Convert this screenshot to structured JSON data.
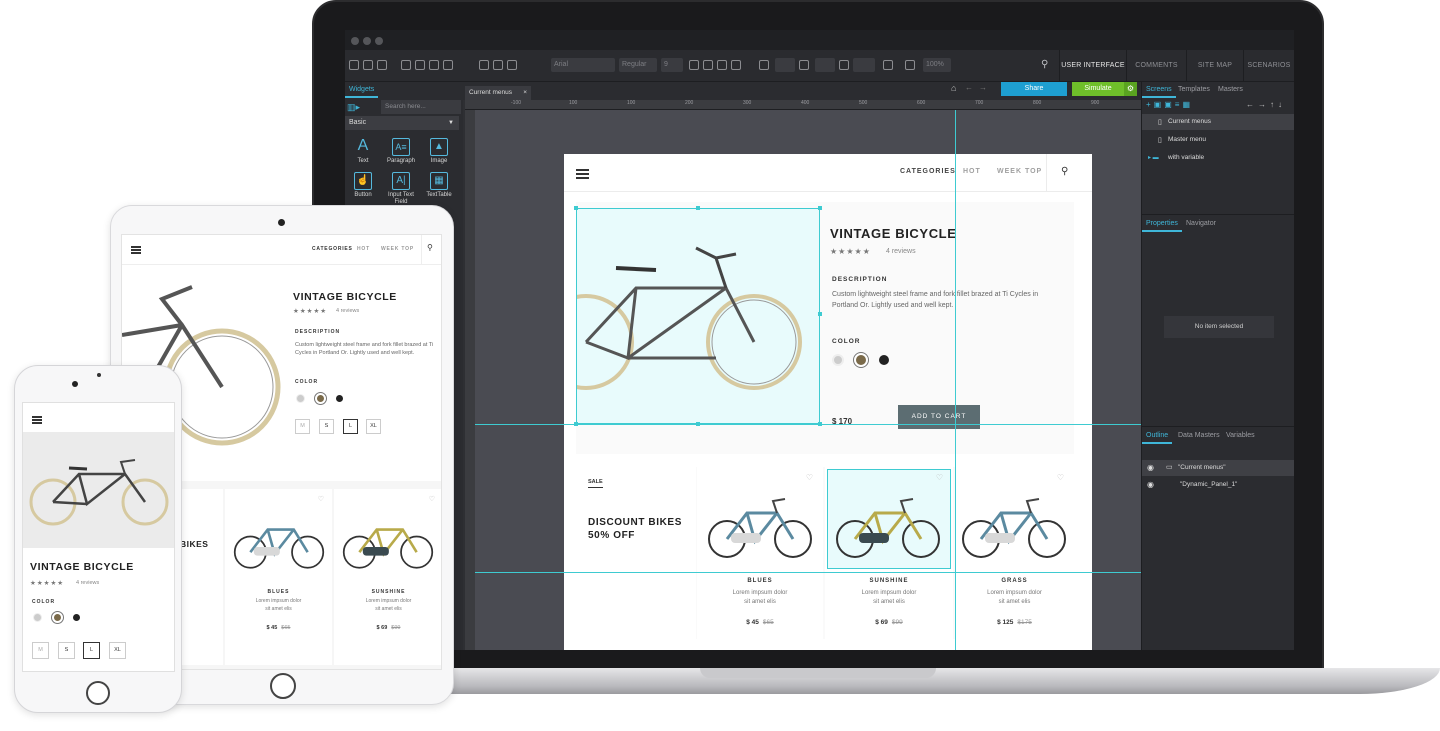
{
  "editor": {
    "zoom": "100%",
    "font_field": "Arial",
    "style_field": "Regular",
    "size_field": "9",
    "top_tabs": [
      "USER INTERFACE",
      "COMMENTS",
      "SITE MAP",
      "SCENARIOS"
    ],
    "left_tab": "Widgets",
    "search_placeholder": "Search here...",
    "library": "Basic",
    "widgets": [
      "Text",
      "Paragraph",
      "Image",
      "Button",
      "Input Text Field",
      "TextTable"
    ],
    "doc_tab": "Current menus",
    "share_label": "Share",
    "simulate_label": "Simulate",
    "ruler_marks": [
      "-100",
      "100",
      "100",
      "200",
      "300",
      "400",
      "500",
      "600",
      "700",
      "800",
      "900",
      "1000",
      "1100"
    ],
    "right_tabs": [
      "Screens",
      "Templates",
      "Masters"
    ],
    "screens": [
      "Current menus",
      "Master menu",
      "with variable"
    ],
    "prop_tabs": [
      "Properties",
      "Navigator"
    ],
    "no_item": "No item selected",
    "outline_tabs": [
      "Outline",
      "Data Masters",
      "Variables"
    ],
    "outline_items": [
      "\"Current menus\"",
      "\"Dynamic_Panel_1\""
    ],
    "accent": "#3fb6d8",
    "share_color": "#1e9fd1",
    "simulate_color": "#6fbf2a"
  },
  "design": {
    "nav": [
      "CATEGORIES",
      "HOT",
      "WEEK TOP"
    ],
    "product": {
      "title": "VINTAGE BICYCLE",
      "stars": "★★★★★",
      "reviews": "4 reviews",
      "description_label": "DESCRIPTION",
      "description": "Custom lightweight steel frame and fork fillet brazed at Ti Cycles in Portland Or. Lightly used and well kept.",
      "color_label": "COLOR",
      "price": "$ 170",
      "cta": "ADD TO CART",
      "sizes": [
        "M",
        "S",
        "L",
        "XL"
      ],
      "swatches": [
        "#cccccc",
        "#7a6a4a",
        "#222222"
      ]
    },
    "promo": {
      "tag": "SALE",
      "title_line1": "DISCOUNT BIKES",
      "title_line2": "50% OFF",
      "tablet_partial": "BIKES"
    },
    "cards": [
      {
        "name": "BLUES",
        "desc1": "Lorem impsum dolor",
        "desc2": "sit amet elis",
        "price": "$ 45",
        "old": "$65",
        "frame": "#5b8aa0"
      },
      {
        "name": "SUNSHINE",
        "desc1": "Lorem impsum dolor",
        "desc2": "sit amet elis",
        "price": "$ 69",
        "old": "$99",
        "frame": "#b8aa4a"
      },
      {
        "name": "GRASS",
        "desc1": "Lorem impsum dolor",
        "desc2": "sit amet elis",
        "price": "$ 125",
        "old": "$175",
        "frame": "#5b8aa0"
      }
    ]
  }
}
